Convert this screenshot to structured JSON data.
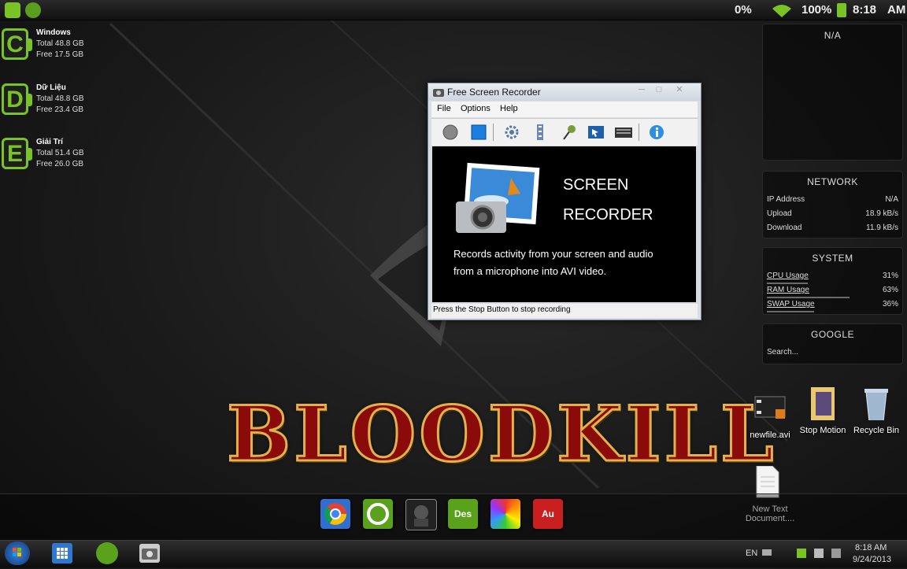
{
  "topbar": {
    "battery_percent_left": "0%",
    "battery_percent": "100%",
    "time": "8:18",
    "ampm": "AM"
  },
  "drives": [
    {
      "letter": "C",
      "name": "Windows",
      "total": "Total 48.8 GB",
      "free": "Free 17.5 GB"
    },
    {
      "letter": "D",
      "name": "Dữ Liệu",
      "total": "Total 48.8 GB",
      "free": "Free 23.4 GB"
    },
    {
      "letter": "E",
      "name": "Giải Trí",
      "total": "Total 51.4 GB",
      "free": "Free 26.0 GB"
    }
  ],
  "gadgets": {
    "top": {
      "label": "N/A"
    },
    "network": {
      "title": "NETWORK",
      "rows": [
        {
          "label": "IP Address",
          "value": "N/A"
        },
        {
          "label": "Upload",
          "value": "18.9 kB/s"
        },
        {
          "label": "Download",
          "value": "11.9 kB/s"
        }
      ]
    },
    "system": {
      "title": "SYSTEM",
      "rows": [
        {
          "label": "CPU Usage",
          "value": "31%",
          "fraction": 0.31
        },
        {
          "label": "RAM Usage",
          "value": "63%",
          "fraction": 0.63
        },
        {
          "label": "SWAP Usage",
          "value": "36%",
          "fraction": 0.36
        }
      ]
    },
    "google": {
      "title": "GOOGLE",
      "placeholder": "Search..."
    }
  },
  "window": {
    "title": "Free Screen Recorder",
    "menu": [
      "File",
      "Options",
      "Help"
    ],
    "heading1": "SCREEN",
    "heading2": "RECORDER",
    "desc1": "Records activity from your screen and audio",
    "desc2": "from a microphone into AVI video.",
    "status": "Press the Stop Button to stop recording"
  },
  "logo_text": "BLOODKILL",
  "desktop_icons": [
    {
      "label": "newfile.avi"
    },
    {
      "label": "Stop Motion"
    },
    {
      "label": "Recycle Bin"
    },
    {
      "label": "New Text Document...."
    }
  ],
  "dock": [
    {
      "name": "chrome",
      "label": ""
    },
    {
      "name": "green-app",
      "label": ""
    },
    {
      "name": "game",
      "label": ""
    },
    {
      "name": "des",
      "label": "Des"
    },
    {
      "name": "colors",
      "label": ""
    },
    {
      "name": "au",
      "label": "Au"
    }
  ],
  "taskbar": {
    "lang": "EN",
    "time": "8:18 AM",
    "date": "9/24/2013"
  },
  "colors": {
    "accent_green": "#79c325",
    "brand_red": "#8b0b0b"
  }
}
